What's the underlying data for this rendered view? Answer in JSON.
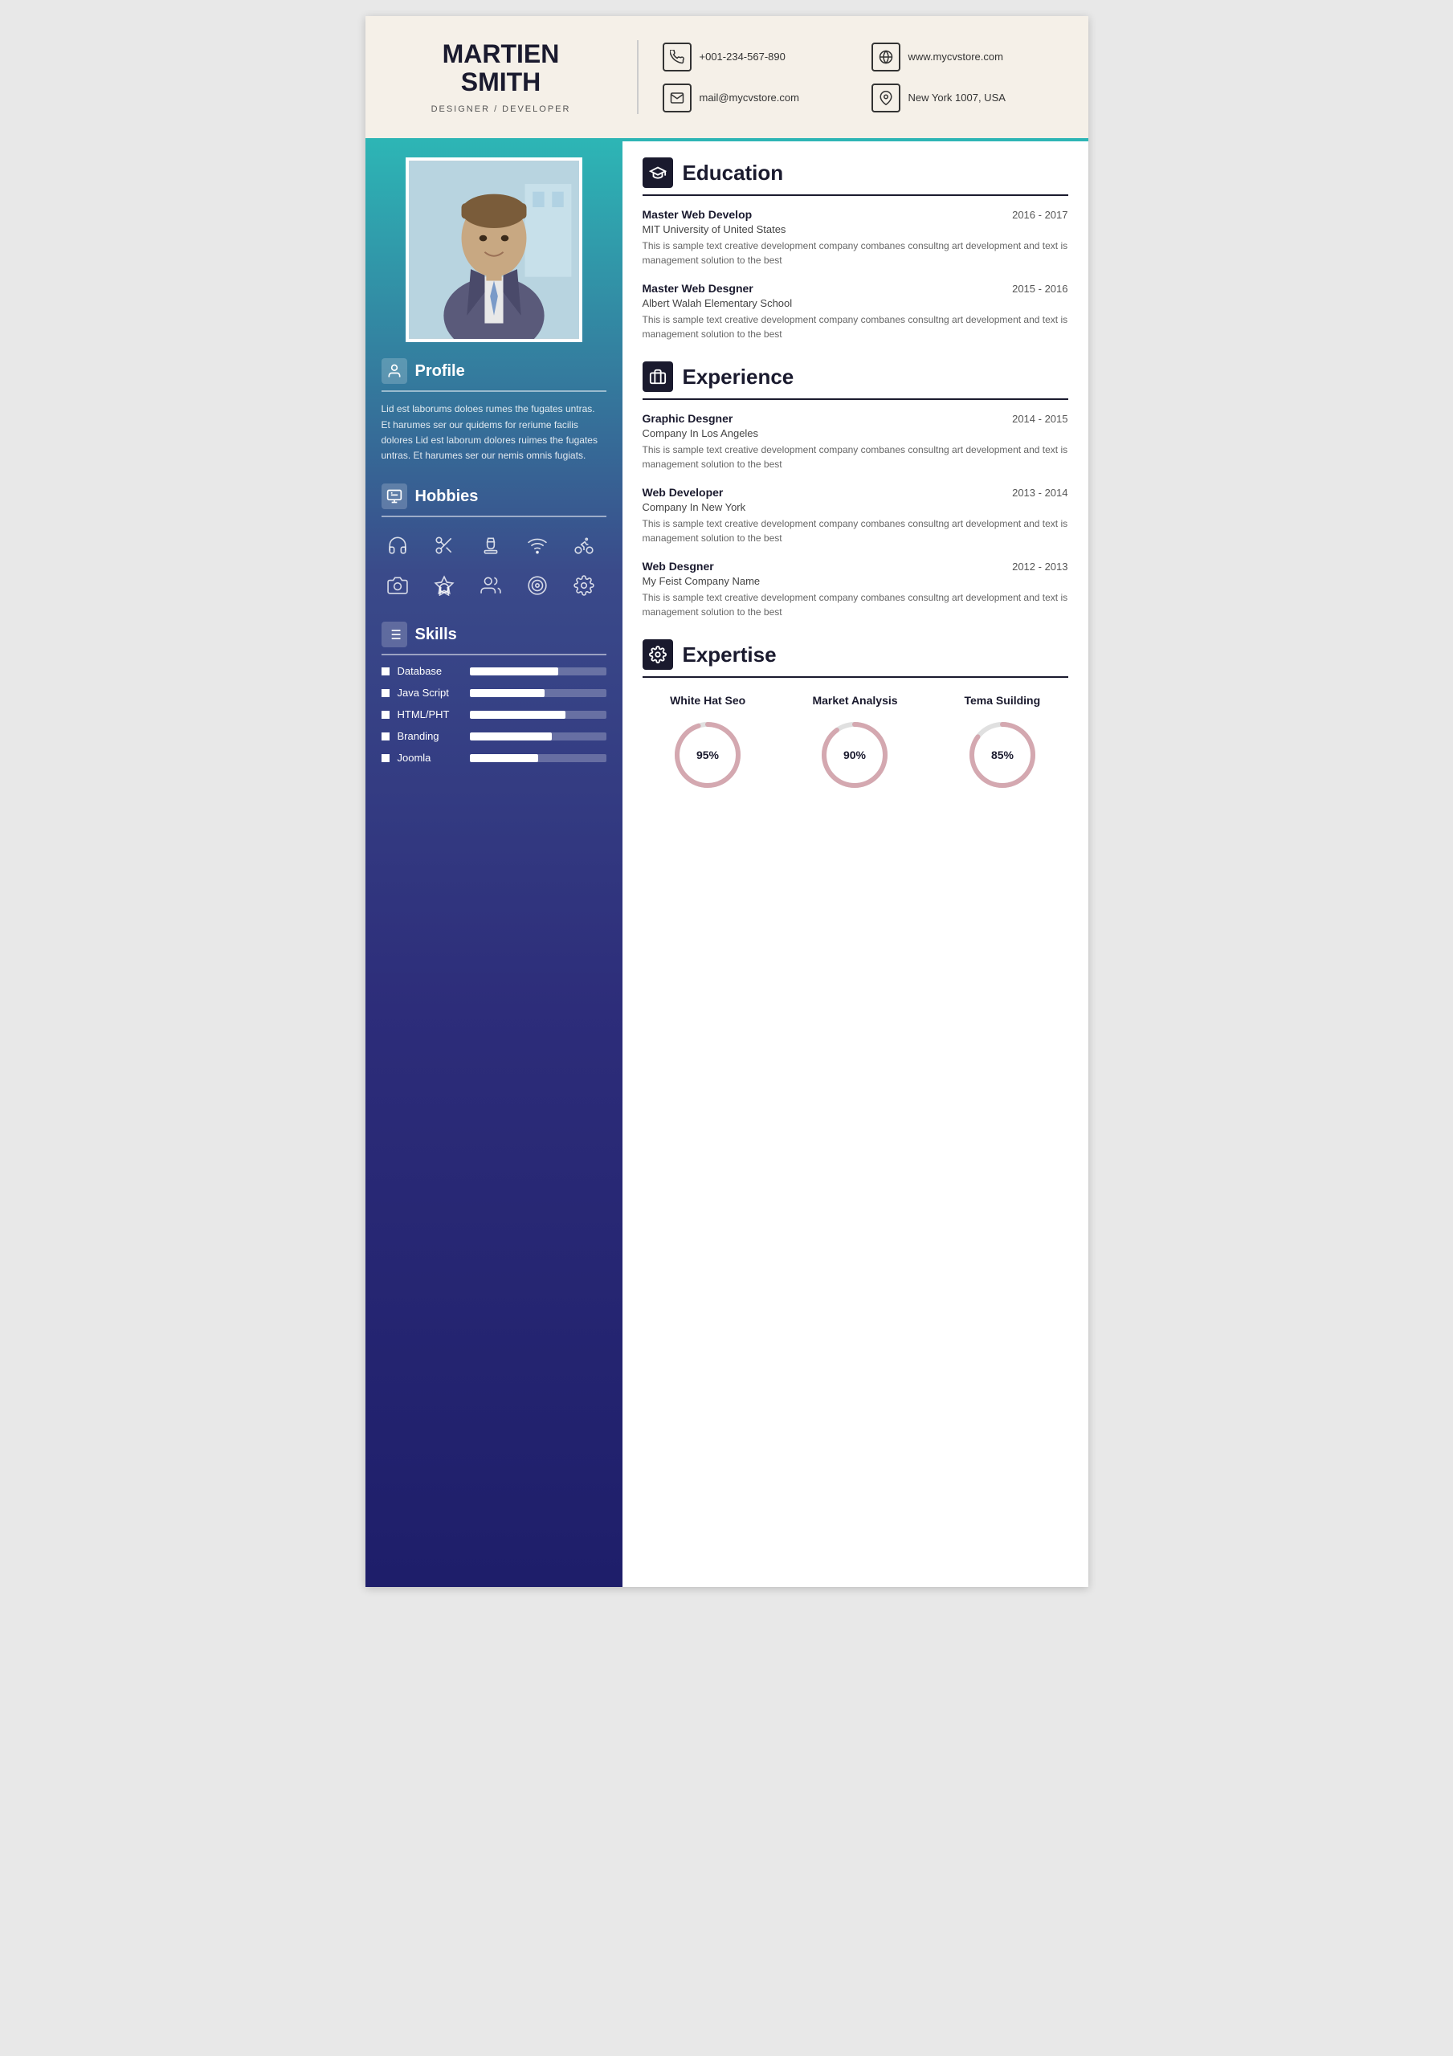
{
  "header": {
    "name_line1": "MARTIEN",
    "name_line2": "SMITH",
    "title": "DESIGNER / DEVELOPER",
    "contacts": [
      {
        "icon": "📞",
        "text": "+001-234-567-890",
        "name": "phone"
      },
      {
        "icon": "🌐",
        "text": "www.mycvstore.com",
        "name": "website"
      },
      {
        "icon": "✉",
        "text": "mail@mycvstore.com",
        "name": "email"
      },
      {
        "icon": "📍",
        "text": "New York 1007, USA",
        "name": "location"
      }
    ]
  },
  "sidebar": {
    "profile_section_title": "Profile",
    "profile_text": "Lid est laborums doloes rumes the fugates untras. Et harumes ser our quidems for reriume facilis dolores Lid est laborum dolores ruimes the fugates untras. Et harumes ser our nemis omnis fugiats.",
    "hobbies_section_title": "Hobbies",
    "hobbies": [
      "🎧",
      "✂",
      "♟",
      "📡",
      "🚲",
      "📷",
      "🏅",
      "👥",
      "🎯",
      "⚙"
    ],
    "skills_section_title": "Skills",
    "skills": [
      {
        "name": "Database",
        "percent": 65
      },
      {
        "name": "Java Script",
        "percent": 55
      },
      {
        "name": "HTML/PHT",
        "percent": 70
      },
      {
        "name": "Branding",
        "percent": 60
      },
      {
        "name": "Joomla",
        "percent": 50
      }
    ]
  },
  "education": {
    "section_title": "Education",
    "entries": [
      {
        "title": "Master Web Develop",
        "date": "2016 - 2017",
        "subtitle": "MIT University of United States",
        "desc": "This is sample text creative development company combanes consultng art development and text is management solution to the best"
      },
      {
        "title": "Master Web Desgner",
        "date": "2015 - 2016",
        "subtitle": "Albert Walah Elementary School",
        "desc": "This is sample text creative development company combanes consultng art development and text is management solution to the best"
      }
    ]
  },
  "experience": {
    "section_title": "Experience",
    "entries": [
      {
        "title": "Graphic Desgner",
        "date": "2014 - 2015",
        "subtitle": "Company In Los Angeles",
        "desc": "This is sample text creative development company combanes consultng art development and text is management solution to the best"
      },
      {
        "title": "Web Developer",
        "date": "2013 - 2014",
        "subtitle": "Company In New York",
        "desc": "This is sample text creative development company combanes consultng art development and text is management solution to the best"
      },
      {
        "title": "Web Desgner",
        "date": "2012 - 2013",
        "subtitle": "My Feist Company Name",
        "desc": "This is sample text creative development company combanes consultng art development and text is management solution to the best"
      }
    ]
  },
  "expertise": {
    "section_title": "Expertise",
    "items": [
      {
        "label": "White Hat Seo",
        "percent": 95
      },
      {
        "label": "Market Analysis",
        "percent": 90
      },
      {
        "label": "Tema Suilding",
        "percent": 85
      }
    ]
  }
}
